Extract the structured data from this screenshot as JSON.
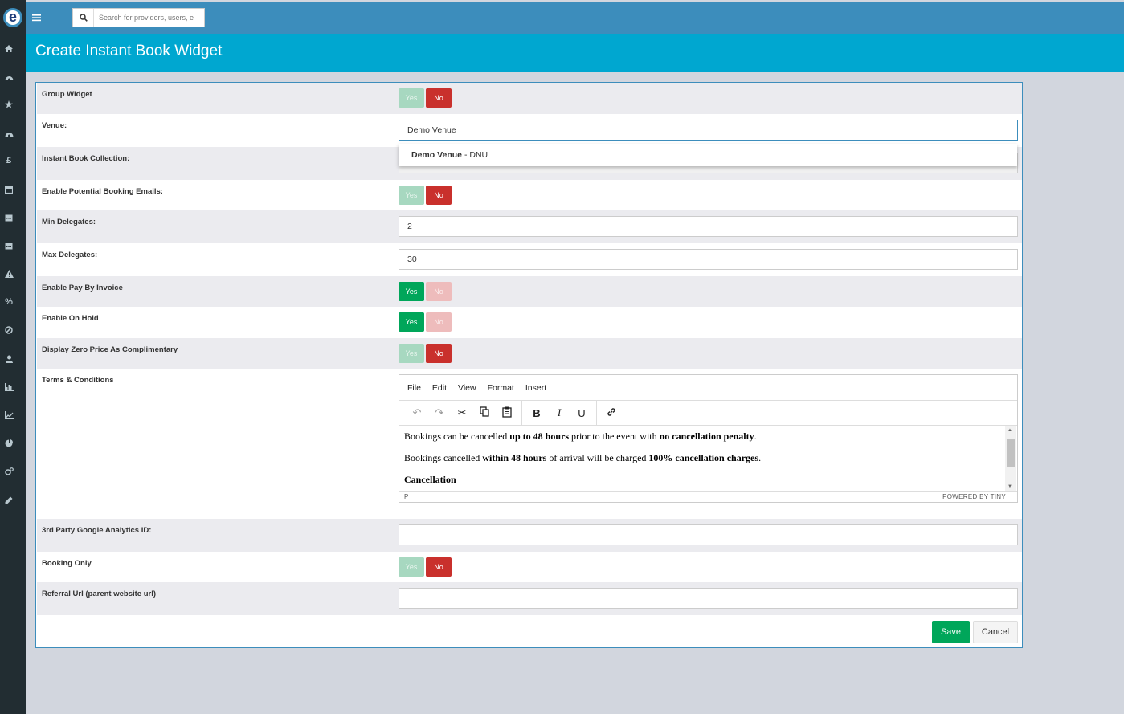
{
  "topbar": {
    "menu_icon": "menu-icon",
    "search_icon": "search-icon",
    "search_placeholder": "Search for providers, users, e"
  },
  "sidebar": {
    "logo_letter": "e",
    "icons": [
      "home-icon",
      "dashboard-icon",
      "star-icon",
      "dashboard-icon",
      "pound-icon",
      "calendar-icon",
      "calendar-icon",
      "calendar-icon",
      "warning-icon",
      "percent-icon",
      "ban-icon",
      "user-icon",
      "bar-chart-icon",
      "line-chart-icon",
      "pie-chart-icon",
      "cogs-icon",
      "pencil-icon"
    ],
    "pound_symbol": "£",
    "percent_symbol": "%"
  },
  "page_title": "Create Instant Book Widget",
  "toggle_labels": {
    "yes": "Yes",
    "no": "No"
  },
  "form": {
    "group_widget": {
      "label": "Group Widget",
      "value": "No"
    },
    "venue": {
      "label": "Venue:",
      "value": "Demo Venue",
      "suggestion_bold": "Demo Venue",
      "suggestion_rest": " - DNU"
    },
    "collection": {
      "label": "Instant Book Collection:"
    },
    "potential_emails": {
      "label": "Enable Potential Booking Emails:",
      "value": "No"
    },
    "min_delegates": {
      "label": "Min Delegates:",
      "value": "2"
    },
    "max_delegates": {
      "label": "Max Delegates:",
      "value": "30"
    },
    "pay_by_invoice": {
      "label": "Enable Pay By Invoice",
      "value": "Yes"
    },
    "on_hold": {
      "label": "Enable On Hold",
      "value": "Yes"
    },
    "zero_price": {
      "label": "Display Zero Price As Complimentary",
      "value": "No"
    },
    "terms": {
      "label": "Terms & Conditions",
      "menu": [
        "File",
        "Edit",
        "View",
        "Format",
        "Insert"
      ],
      "p1_a": "Bookings can be cancelled ",
      "p1_b": "up to 48 hours",
      "p1_c": " prior to the event with ",
      "p1_d": "no cancellation penalty",
      "p1_e": ".",
      "p2_a": "Bookings cancelled ",
      "p2_b": "within 48 hours",
      "p2_c": " of arrival will be charged ",
      "p2_d": "100% cancellation charges",
      "p2_e": ".",
      "p3": "Cancellation",
      "status_path": "P",
      "powered": "POWERED BY TINY"
    },
    "ga_id": {
      "label": "3rd Party Google Analytics ID:",
      "value": ""
    },
    "booking_only": {
      "label": "Booking Only",
      "value": "No"
    },
    "referral_url": {
      "label": "Referral Url (parent website url)",
      "value": ""
    }
  },
  "actions": {
    "save": "Save",
    "cancel": "Cancel"
  }
}
